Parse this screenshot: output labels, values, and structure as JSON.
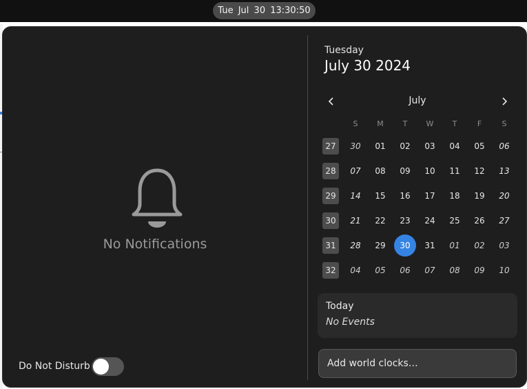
{
  "topbar": {
    "clock": "Tue Jul 30  13:30:50"
  },
  "notifications": {
    "empty_text": "No Notifications",
    "icon": "bell-icon",
    "dnd_label": "Do Not Disturb",
    "dnd_enabled": false
  },
  "calendar": {
    "day_name": "Tuesday",
    "full_date": "July 30 2024",
    "month": "July",
    "weekdays": [
      "S",
      "M",
      "T",
      "W",
      "T",
      "F",
      "S"
    ],
    "weeks": [
      {
        "num": "27",
        "days": [
          "30",
          "01",
          "02",
          "03",
          "04",
          "05",
          "06"
        ]
      },
      {
        "num": "28",
        "days": [
          "07",
          "08",
          "09",
          "10",
          "11",
          "12",
          "13"
        ]
      },
      {
        "num": "29",
        "days": [
          "14",
          "15",
          "16",
          "17",
          "18",
          "19",
          "20"
        ]
      },
      {
        "num": "30",
        "days": [
          "21",
          "22",
          "23",
          "24",
          "25",
          "26",
          "27"
        ]
      },
      {
        "num": "31",
        "days": [
          "28",
          "29",
          "30",
          "31",
          "01",
          "02",
          "03"
        ]
      },
      {
        "num": "32",
        "days": [
          "04",
          "05",
          "06",
          "07",
          "08",
          "09",
          "10"
        ]
      }
    ],
    "today": "30"
  },
  "events": {
    "title": "Today",
    "empty": "No Events"
  },
  "world_clocks": {
    "label": "Add world clocks…"
  },
  "colors": {
    "accent": "#3584e4",
    "panel": "#1e1e1e",
    "topbar": "#111111"
  }
}
